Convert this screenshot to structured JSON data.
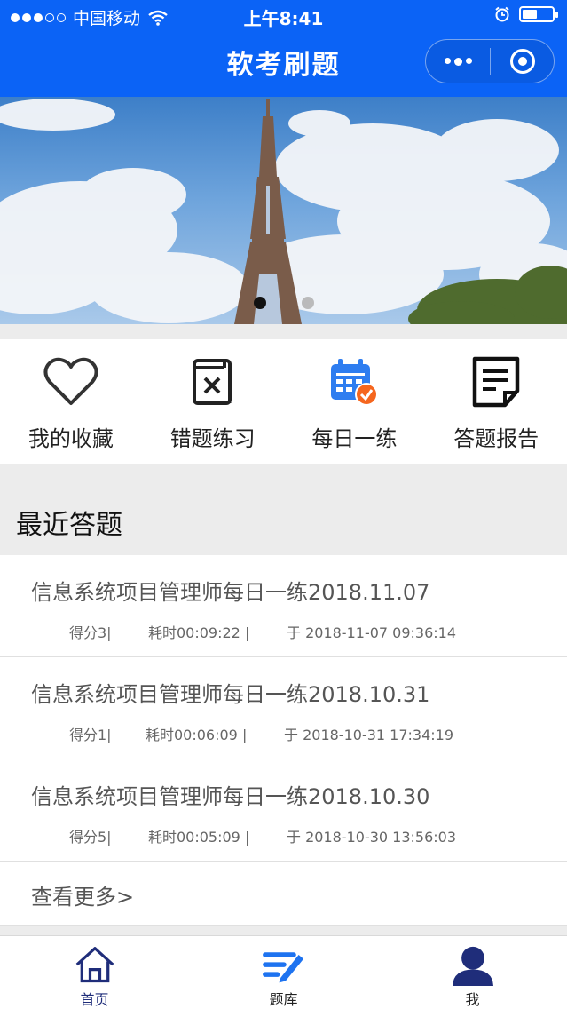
{
  "status_bar": {
    "carrier": "中国移动",
    "time": "上午8:41"
  },
  "nav": {
    "title": "软考刷题"
  },
  "banner": {
    "slides": 2,
    "active_index": 0
  },
  "menu": {
    "items": [
      {
        "label": "我的收藏",
        "icon": "heart-icon"
      },
      {
        "label": "错题练习",
        "icon": "wrong-questions-icon"
      },
      {
        "label": "每日一练",
        "icon": "calendar-check-icon"
      },
      {
        "label": "答题报告",
        "icon": "report-icon"
      }
    ]
  },
  "recent": {
    "heading": "最近答题",
    "items": [
      {
        "title": "信息系统项目管理师每日一练2018.11.07",
        "score": "得分3|",
        "duration": "耗时00:09:22 |",
        "time": "于 2018-11-07 09:36:14"
      },
      {
        "title": "信息系统项目管理师每日一练2018.10.31",
        "score": "得分1|",
        "duration": "耗时00:06:09 |",
        "time": "于 2018-10-31 17:34:19"
      },
      {
        "title": "信息系统项目管理师每日一练2018.10.30",
        "score": "得分5|",
        "duration": "耗时00:05:09 |",
        "time": "于 2018-10-30 13:56:03"
      }
    ],
    "more": "查看更多>"
  },
  "tabbar": {
    "tabs": [
      {
        "label": "首页",
        "icon": "home-icon"
      },
      {
        "label": "题库",
        "icon": "question-bank-icon"
      },
      {
        "label": "我",
        "icon": "user-icon"
      }
    ]
  },
  "colors": {
    "brand": "#0b63f6",
    "tab_active": "#1f2d7a",
    "calendar": "#2e7df0",
    "badge": "#f5661e"
  }
}
